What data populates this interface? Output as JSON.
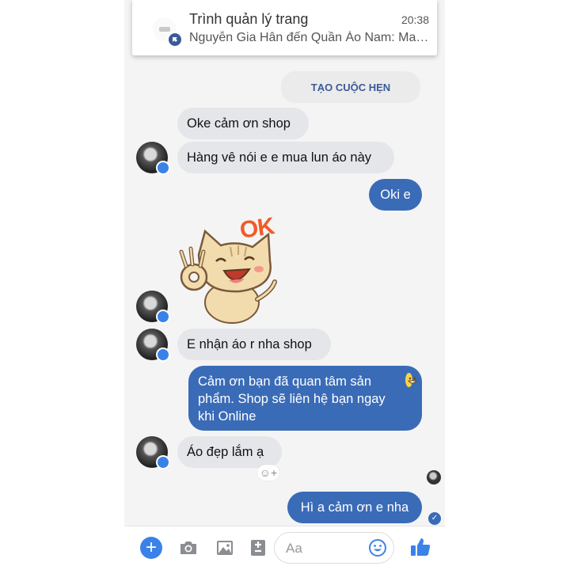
{
  "notification": {
    "title": "Trình quản lý trang",
    "time": "20:38",
    "subtitle": "Nguyễn Gia Hân đến Quần Áo Nam: Mai ..."
  },
  "appointment_button": "TẠO CUỘC HẸN",
  "messages": {
    "m1": "Oke cảm ơn shop",
    "m2": "Hàng vê nói e e mua lun áo này",
    "m3": "Oki e",
    "sticker_text": "OK",
    "m4": "E nhận áo r nha shop",
    "m5": "Cảm ơn bạn đã quan tâm sản phẩm. Shop sẽ liên hệ bạn ngay khi Online",
    "m6": "Áo đẹp lắm ạ",
    "m7": "Hì a cảm ơn e nha"
  },
  "composer": {
    "placeholder": "Aa"
  },
  "colors": {
    "outgoing_bubble": "#3a6bb7",
    "incoming_bubble": "#e4e6ea",
    "accent": "#3b82e8"
  }
}
